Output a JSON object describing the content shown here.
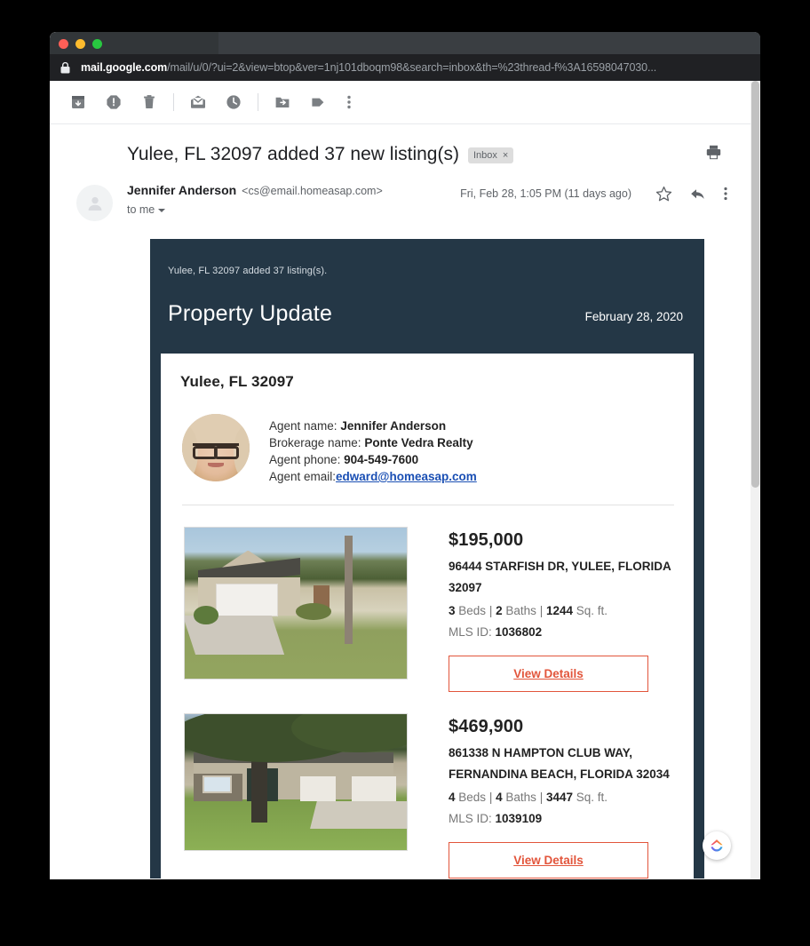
{
  "browser": {
    "url_host": "mail.google.com",
    "url_path": "/mail/u/0/?ui=2&view=btop&ver=1nj101dboqm98&search=inbox&th=%23thread-f%3A16598047030...",
    "lock_icon": "lock-icon"
  },
  "toolbar": {
    "items": [
      {
        "name": "archive",
        "icon": "archive-icon",
        "label": "Archive"
      },
      {
        "name": "report-spam",
        "icon": "report-spam-icon",
        "label": "Report spam"
      },
      {
        "name": "delete",
        "icon": "trash-icon",
        "label": "Delete"
      },
      {
        "name": "mark-unread",
        "icon": "mark-unread-icon",
        "label": "Mark as unread"
      },
      {
        "name": "snooze",
        "icon": "clock-icon",
        "label": "Snooze"
      },
      {
        "name": "move-to",
        "icon": "move-to-folder-icon",
        "label": "Move to"
      },
      {
        "name": "labels",
        "icon": "label-tag-icon",
        "label": "Labels"
      },
      {
        "name": "more",
        "icon": "more-vertical-icon",
        "label": "More"
      }
    ]
  },
  "thread": {
    "subject": "Yulee, FL 32097 added 37 new listing(s)",
    "label_chip": "Inbox",
    "label_chip_remove": "×",
    "print_icon": "print-icon",
    "sender_name": "Jennifer Anderson",
    "sender_email": "<cs@email.homeasap.com>",
    "recipient": "to me",
    "date": "Fri, Feb 28, 1:05 PM (11 days ago)",
    "star_icon": "star-icon",
    "reply_icon": "reply-icon",
    "more_icon": "more-vertical-icon"
  },
  "email": {
    "preheader": "Yulee, FL 32097 added 37 listing(s).",
    "banner_title": "Property Update",
    "banner_date": "February 28, 2020",
    "banner_color": "#243746",
    "card_title": "Yulee, FL 32097",
    "agent": {
      "photo_alt": "agent-photo",
      "name_label": "Agent name:",
      "name_value": "Jennifer Anderson",
      "brokerage_label": "Brokerage name:",
      "brokerage_value": "Ponte Vedra Realty",
      "phone_label": "Agent phone:",
      "phone_value": "904-549-7600",
      "email_label": "Agent email:",
      "email_value": "edward@homeasap.com"
    },
    "accent_color": "#e2553b",
    "listings": [
      {
        "price": "$195,000",
        "address": "96444 STARFISH DR, YULEE, FLORIDA 32097",
        "beds": "3",
        "beds_label": "Beds",
        "baths": "2",
        "baths_label": "Baths",
        "sqft": "1244",
        "sqft_label": "Sq. ft.",
        "mls_label": "MLS ID:",
        "mls_value": "1036802",
        "cta": "View Details"
      },
      {
        "price": "$469,900",
        "address": "861338 N HAMPTON CLUB WAY, FERNANDINA BEACH, FLORIDA 32034",
        "beds": "4",
        "beds_label": "Beds",
        "baths": "4",
        "baths_label": "Baths",
        "sqft": "3447",
        "sqft_label": "Sq. ft.",
        "mls_label": "MLS ID:",
        "mls_value": "1039109",
        "cta": "View Details"
      }
    ],
    "separator": "|"
  },
  "overlay": {
    "badge_icon": "homeasap-chevron-badge-icon"
  }
}
